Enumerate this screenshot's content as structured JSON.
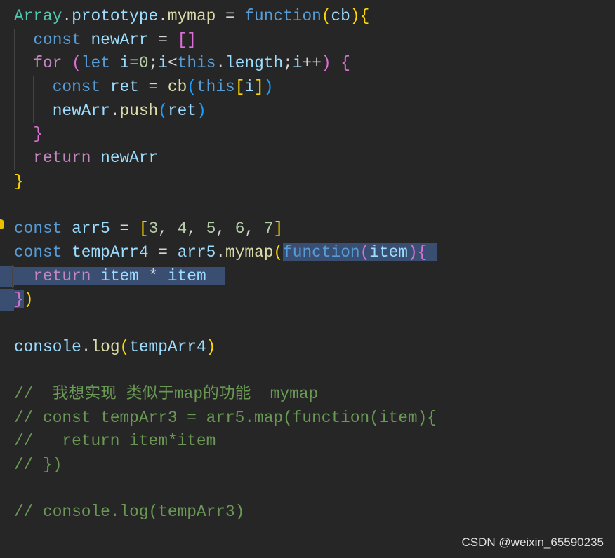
{
  "editor": {
    "lines": [
      [
        [
          "Array",
          "cls"
        ],
        [
          ".",
          "op"
        ],
        [
          "prototype",
          "var"
        ],
        [
          ".",
          "op"
        ],
        [
          "mymap",
          "fn"
        ],
        [
          " = ",
          "op"
        ],
        [
          "function",
          "kw"
        ],
        [
          "(",
          "b1"
        ],
        [
          "cb",
          "var"
        ],
        [
          ")",
          "b1"
        ],
        [
          "{",
          "b1"
        ]
      ],
      [
        [
          "  ",
          "op"
        ],
        [
          "const ",
          "kw"
        ],
        [
          "newArr",
          "var"
        ],
        [
          " = ",
          "op"
        ],
        [
          "[]",
          "b2"
        ]
      ],
      [
        [
          "  ",
          "op"
        ],
        [
          "for ",
          "ctl"
        ],
        [
          "(",
          "b2"
        ],
        [
          "let ",
          "kw"
        ],
        [
          "i",
          "var"
        ],
        [
          "=",
          "op"
        ],
        [
          "0",
          "num"
        ],
        [
          ";",
          "op"
        ],
        [
          "i",
          "var"
        ],
        [
          "<",
          "op"
        ],
        [
          "this",
          "kw"
        ],
        [
          ".",
          "op"
        ],
        [
          "length",
          "var"
        ],
        [
          ";",
          "op"
        ],
        [
          "i",
          "var"
        ],
        [
          "++",
          "op"
        ],
        [
          ")",
          "b2"
        ],
        [
          " ",
          "op"
        ],
        [
          "{",
          "b2"
        ]
      ],
      [
        [
          "    ",
          "op"
        ],
        [
          "const ",
          "kw"
        ],
        [
          "ret",
          "var"
        ],
        [
          " = ",
          "op"
        ],
        [
          "cb",
          "fn"
        ],
        [
          "(",
          "b3"
        ],
        [
          "this",
          "kw"
        ],
        [
          "[",
          "b1"
        ],
        [
          "i",
          "var"
        ],
        [
          "]",
          "b1"
        ],
        [
          ")",
          "b3"
        ]
      ],
      [
        [
          "    ",
          "op"
        ],
        [
          "newArr",
          "var"
        ],
        [
          ".",
          "op"
        ],
        [
          "push",
          "fn"
        ],
        [
          "(",
          "b3"
        ],
        [
          "ret",
          "var"
        ],
        [
          ")",
          "b3"
        ]
      ],
      [
        [
          "  ",
          "op"
        ],
        [
          "}",
          "b2"
        ]
      ],
      [
        [
          "  ",
          "op"
        ],
        [
          "return ",
          "ctl"
        ],
        [
          "newArr",
          "var"
        ]
      ],
      [
        [
          "}",
          "b1"
        ]
      ],
      [],
      [
        [
          "const ",
          "kw"
        ],
        [
          "arr5",
          "var"
        ],
        [
          " = ",
          "op"
        ],
        [
          "[",
          "b1"
        ],
        [
          "3",
          "num"
        ],
        [
          ", ",
          "op"
        ],
        [
          "4",
          "num"
        ],
        [
          ", ",
          "op"
        ],
        [
          "5",
          "num"
        ],
        [
          ", ",
          "op"
        ],
        [
          "6",
          "num"
        ],
        [
          ", ",
          "op"
        ],
        [
          "7",
          "num"
        ],
        [
          "]",
          "b1"
        ]
      ],
      [
        [
          "const ",
          "kw"
        ],
        [
          "tempArr4",
          "var"
        ],
        [
          " = ",
          "op"
        ],
        [
          "arr5",
          "var"
        ],
        [
          ".",
          "op"
        ],
        [
          "mymap",
          "fn"
        ],
        [
          "(",
          "b1"
        ],
        [
          "function",
          "kw",
          1
        ],
        [
          "(",
          "b2",
          1
        ],
        [
          "item",
          "var",
          1
        ],
        [
          ")",
          "b2",
          1
        ],
        [
          "{",
          "b2",
          1
        ],
        [
          " ",
          "op",
          1
        ]
      ],
      [
        [
          "  ",
          "op",
          1
        ],
        [
          "return ",
          "ctl",
          1
        ],
        [
          "item",
          "var",
          1
        ],
        [
          " * ",
          "op",
          1
        ],
        [
          "item",
          "var",
          1
        ],
        [
          "  ",
          "op",
          1
        ]
      ],
      [
        [
          "}",
          "b2",
          1
        ],
        [
          ")",
          "b1"
        ]
      ],
      [],
      [
        [
          "console",
          "var"
        ],
        [
          ".",
          "op"
        ],
        [
          "log",
          "fn"
        ],
        [
          "(",
          "b1"
        ],
        [
          "tempArr4",
          "var"
        ],
        [
          ")",
          "b1"
        ]
      ],
      [],
      [
        [
          "//  我想实现 类似于map的功能  mymap",
          "cm"
        ]
      ],
      [
        [
          "// const tempArr3 = arr5.map(function(item){",
          "cm"
        ]
      ],
      [
        [
          "//   return item*item",
          "cm"
        ]
      ],
      [
        [
          "// })",
          "cm"
        ]
      ],
      [],
      [
        [
          "// console.log(tempArr3)",
          "cm"
        ]
      ]
    ],
    "selection_start_lines": [
      11,
      12
    ]
  },
  "watermark": "CSDN @weixin_65590235",
  "colors": {
    "background": "#262626",
    "selection": "#3a4e72"
  }
}
